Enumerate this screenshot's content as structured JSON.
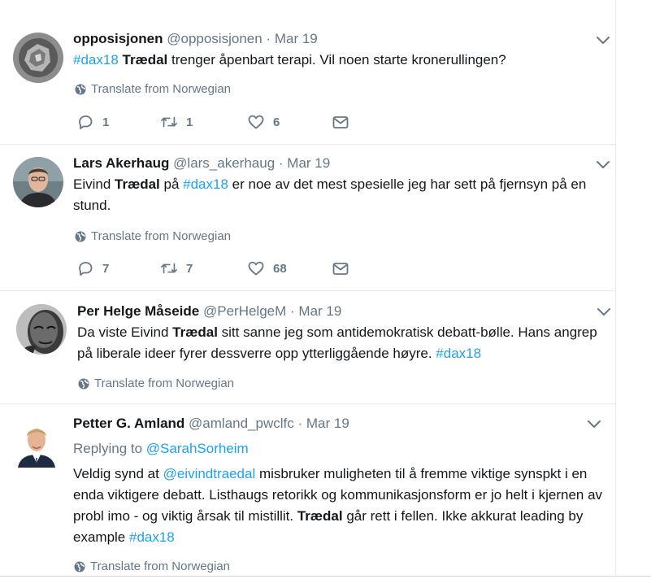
{
  "tweets": [
    {
      "name": "opposisjonen",
      "handle": "@opposisjonen",
      "dot": "·",
      "date": "Mar 19",
      "text": [
        "#dax18",
        " ",
        "Trædal",
        " trenger åpenbart terapi. Vil noen starte kronerullingen?"
      ],
      "translate": "Translate from Norwegian",
      "reply_count": "1",
      "retweet_count": "1",
      "like_count": "6"
    },
    {
      "name": "Lars Akerhaug",
      "handle": "@lars_akerhaug",
      "dot": "·",
      "date": "Mar 19",
      "text": [
        "Eivind ",
        "Trædal",
        " på ",
        "#dax18",
        " er noe av det mest spesielle jeg har sett på fjernsyn på en stund."
      ],
      "translate": "Translate from Norwegian",
      "reply_count": "7",
      "retweet_count": "7",
      "like_count": "68"
    },
    {
      "name": "Per Helge Måseide",
      "handle": "@PerHelgeM",
      "dot": "·",
      "date": "Mar 19",
      "text": [
        "Da viste Eivind ",
        "Trædal",
        " sitt sanne jeg som antidemokratisk debatt-bølle. Hans angrep på liberale ideer fyrer dessverre opp ytterliggående høyre. ",
        "#dax18"
      ],
      "translate": "Translate from Norwegian"
    },
    {
      "name": "Petter G. Amland",
      "handle": "@amland_pwclfc",
      "dot": "·",
      "date": "Mar 19",
      "replying_label": "Replying to ",
      "replying_to": "@SarahSorheim",
      "text": [
        "Veldig synd at ",
        "@eivindtraedal",
        " misbruker muligheten til å fremme viktige synspkt i en enda viktigere debatt. Listhaugs retorikk og kommunikasjonsform er jo helt i kjernen av probl imo - og viktig årsak til mistillit. ",
        "Trædal",
        " går rett i fellen. Ikke akkurat leading by example ",
        "#dax18"
      ],
      "translate": "Translate from Norwegian"
    }
  ],
  "icons": {
    "reply": "reply-icon",
    "retweet": "retweet-icon",
    "like": "heart-icon",
    "dm": "envelope-icon",
    "more": "chevron-down-icon",
    "translate": "globe-icon"
  },
  "colors": {
    "link": "#1da1f2",
    "muted": "#657786",
    "text": "#14171a",
    "divider": "#e6ecf0"
  }
}
